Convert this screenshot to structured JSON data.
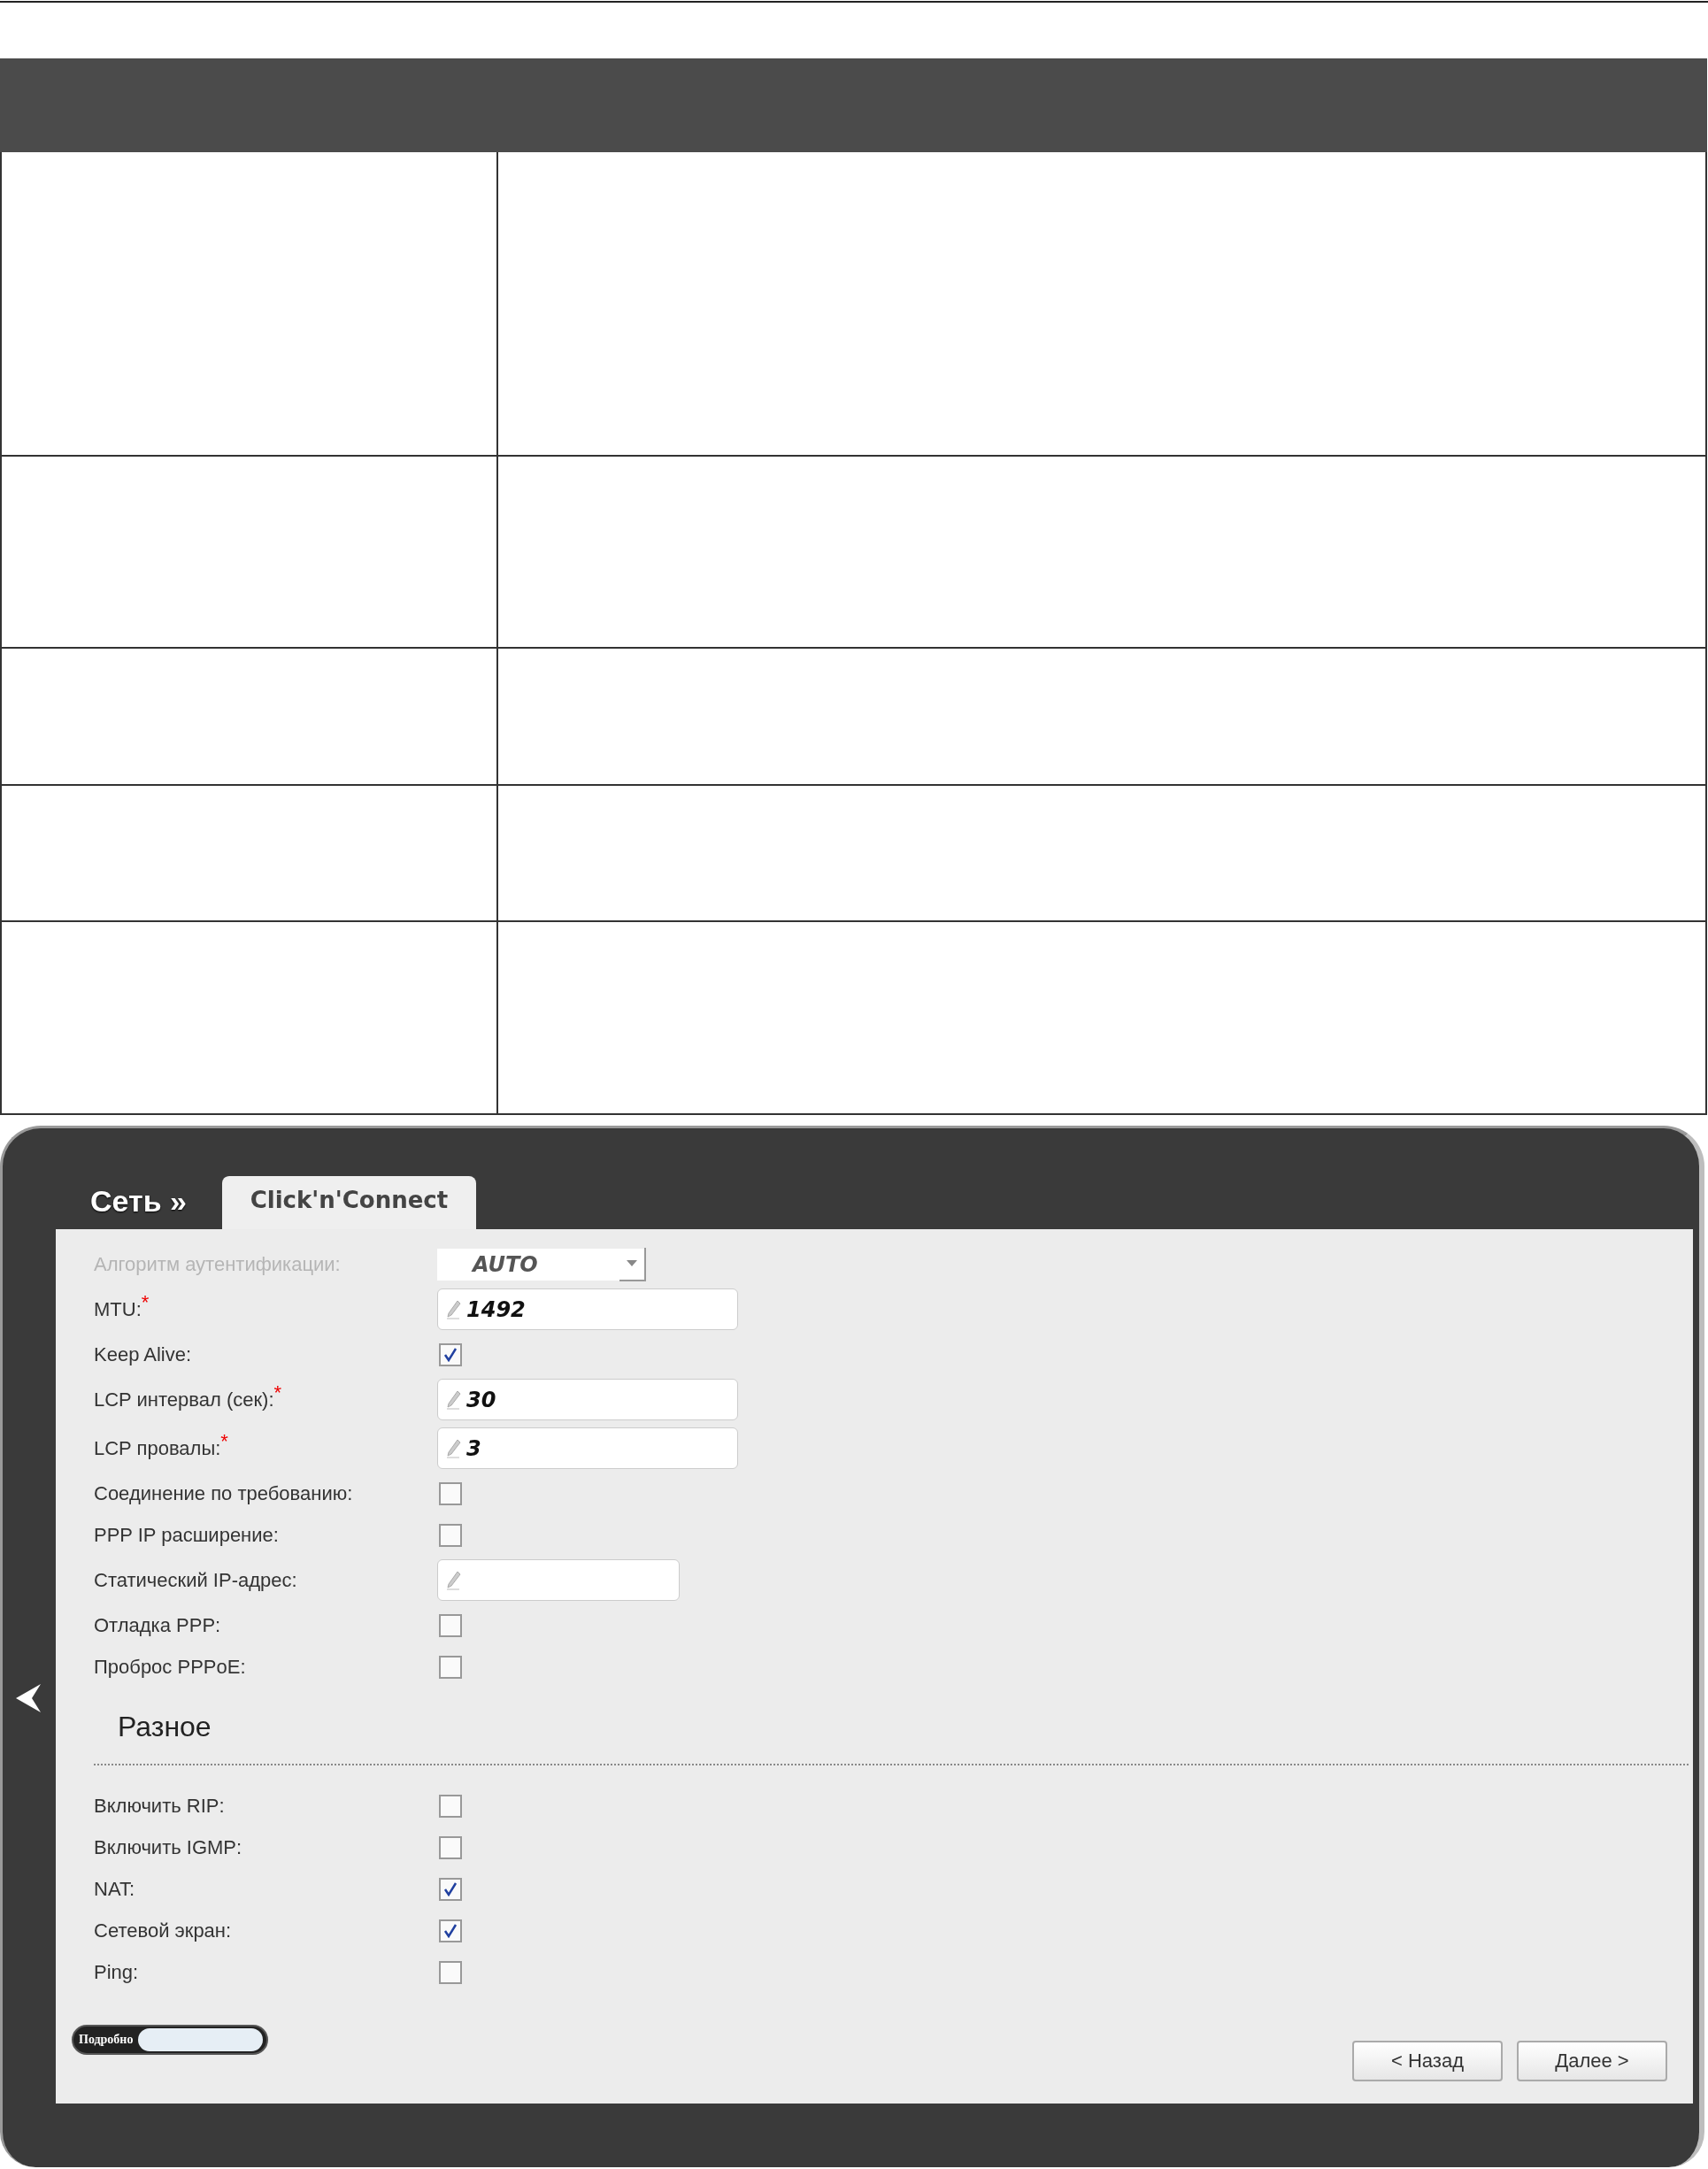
{
  "breadcrumb": "Сеть »",
  "tab": {
    "label": "Click'n'Connect",
    "selected": true
  },
  "rows": [
    {
      "kind": "select",
      "label": "Алгоритм аутентификации:",
      "value": "AUTO",
      "disabled": true
    },
    {
      "kind": "input",
      "label": "MTU:$^{*}$",
      "value": "1492",
      "disabled": false
    },
    {
      "kind": "checkbox",
      "label": "Keep Alive:",
      "checked": true
    },
    {
      "kind": "input",
      "label": "LCP интервал (сек):$^{*}$",
      "value": "30",
      "disabled": false
    },
    {
      "kind": "input",
      "label": "LCP провалы:$^{*}$",
      "value": "3",
      "disabled": false
    },
    {
      "kind": "checkbox",
      "label": "Соединение по требованию:",
      "checked": false
    },
    {
      "kind": "checkbox",
      "label": "PPP IP расширение:",
      "checked": false
    },
    {
      "kind": "input_short",
      "label": "Статический IP-адрес:",
      "disabled": false
    },
    {
      "kind": "checkbox",
      "label": "Отладка PPP:",
      "checked": false
    },
    {
      "kind": "checkbox",
      "label": "Проброс PPPoE:",
      "checked": false
    },
    {
      "kind": "heading",
      "label": "Разное"
    },
    {
      "kind": "checkbox",
      "label": "Включить RIP:",
      "checked": false
    },
    {
      "kind": "checkbox",
      "label": "Включить IGMP:",
      "checked": false
    },
    {
      "kind": "checkbox",
      "label": "NAT:",
      "checked": true
    },
    {
      "kind": "checkbox",
      "label": "Сетевой экран:",
      "checked": true
    },
    {
      "kind": "checkbox",
      "label": "Ping:",
      "checked": false
    }
  ],
  "toggle": {
    "label": "Подробно",
    "on": false
  },
  "buttons": [
    "< Назад",
    "Далее >"
  ]
}
